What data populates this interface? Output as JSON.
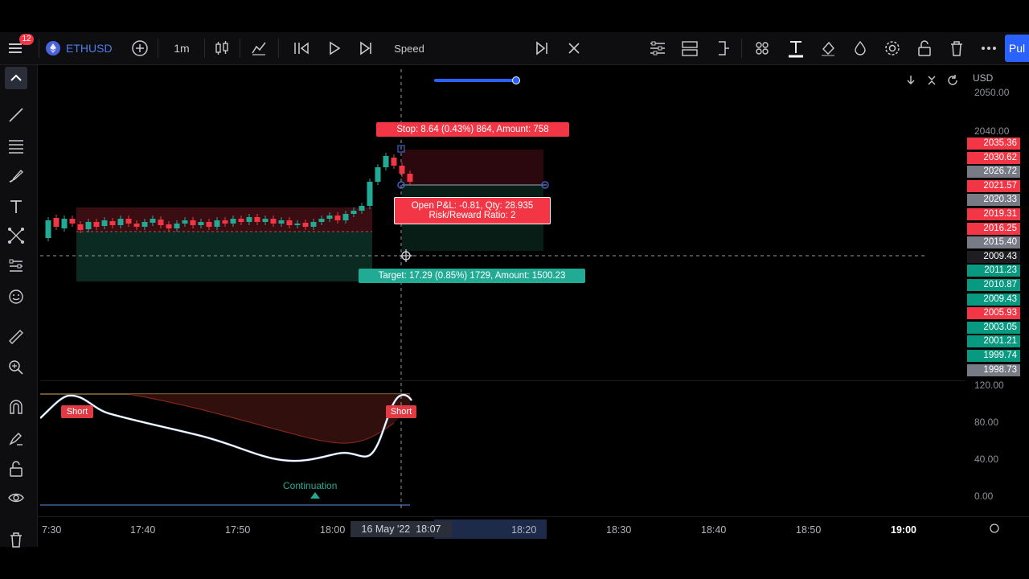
{
  "toolbar": {
    "notif_count": "12",
    "symbol": "ETHUSD",
    "interval": "1m",
    "speed_label": "Speed",
    "publish_label": "Pul"
  },
  "chart_header": {
    "currency": "USD"
  },
  "position": {
    "stop_label": "Stop: 8.64 (0.43%) 864, Amount: 758",
    "pnl_label": "Open P&L: -0.81, Qty: 28.935",
    "rr_label": "Risk/Reward Ratio: 2",
    "target_label": "Target: 17.29 (0.85%) 1729, Amount: 1500.23"
  },
  "price_scale": {
    "ticks": [
      {
        "label": "2050.00",
        "value": 2050
      },
      {
        "label": "2040.00",
        "value": 2040
      }
    ],
    "labels": [
      {
        "text": "2035.36",
        "color": "#f23645"
      },
      {
        "text": "2030.62",
        "color": "#f23645"
      },
      {
        "text": "2026.72",
        "color": "#787b86"
      },
      {
        "text": "2021.57",
        "color": "#f23645"
      },
      {
        "text": "2020.33",
        "color": "#787b86"
      },
      {
        "text": "2019.31",
        "color": "#f23645"
      },
      {
        "text": "2016.25",
        "color": "#f23645"
      },
      {
        "text": "2015.40",
        "color": "#787b86"
      },
      {
        "text": "2009.43",
        "color": "#1e1e22"
      },
      {
        "text": "2011.23",
        "color": "#089981"
      },
      {
        "text": "2010.87",
        "color": "#089981"
      },
      {
        "text": "2009.43",
        "color": "#089981"
      },
      {
        "text": "2005.93",
        "color": "#f23645"
      },
      {
        "text": "2003.05",
        "color": "#089981"
      },
      {
        "text": "2001.21",
        "color": "#089981"
      },
      {
        "text": "1999.74",
        "color": "#089981"
      },
      {
        "text": "1998.73",
        "color": "#787b86"
      }
    ]
  },
  "osc_scale": [
    "120.00",
    "80.00",
    "40.00",
    "0.00"
  ],
  "osc_labels": {
    "short1": "Short",
    "short2": "Short",
    "continuation": "Continuation"
  },
  "time_axis": {
    "labels": [
      "7:30",
      "17:40",
      "17:50",
      "18:00",
      "18:20",
      "18:30",
      "18:40",
      "18:50",
      "19:00"
    ],
    "cursor_date": "16 May '22",
    "cursor_time": "18:07"
  },
  "colors": {
    "up": "#22ab94",
    "down": "#f23645",
    "bg": "#000000"
  }
}
